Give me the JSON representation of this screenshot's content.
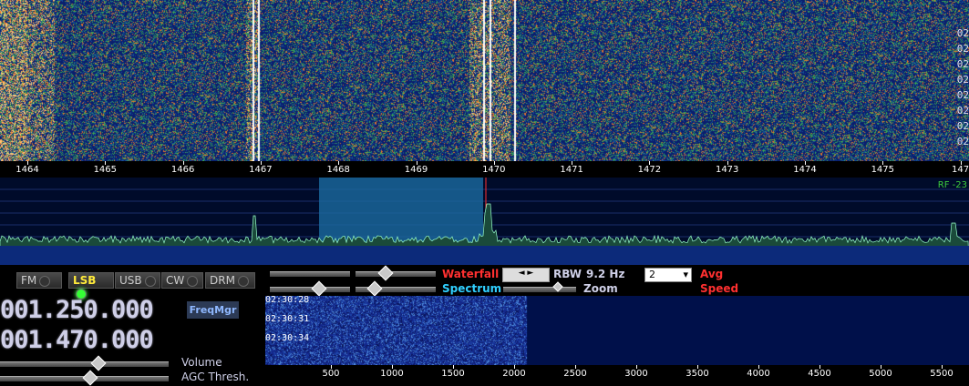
{
  "waterfall": {
    "time_labels": [
      "02",
      "02",
      "02",
      "02",
      "02",
      "02",
      "02",
      "02"
    ]
  },
  "main_axis": {
    "ticks": [
      "1464",
      "1465",
      "1466",
      "1467",
      "1468",
      "1469",
      "1470",
      "1471",
      "1472",
      "1473",
      "1474",
      "1475",
      "147"
    ]
  },
  "spectrum": {
    "rf_label": "RF -23"
  },
  "modes": [
    {
      "label": "FM",
      "active": false
    },
    {
      "label": "LSB",
      "active": true
    },
    {
      "label": "USB",
      "active": false
    },
    {
      "label": "CW",
      "active": false
    },
    {
      "label": "DRM",
      "active": false
    }
  ],
  "frequencies": {
    "vfo_a": "001.250.000",
    "vfo_b": "001.470.000",
    "freqmgr_label": "FreqMgr"
  },
  "sliders": {
    "volume_label": "Volume",
    "agc_label": "AGC Thresh."
  },
  "display_controls": {
    "waterfall_label": "Waterfall",
    "spectrum_label": "Spectrum",
    "zoom_label": "Zoom",
    "rbw_label": "RBW",
    "rbw_value": "9.2 Hz",
    "avg_value": "2",
    "avg_label": "Avg",
    "speed_label": "Speed",
    "colors": {
      "waterfall": "#ff3030",
      "spectrum": "#30d0ff",
      "avg": "#ff3030",
      "speed": "#ff3030"
    }
  },
  "audio_waterfall": {
    "time_labels": [
      "02:30:28",
      "02:30:31",
      "02:30:34"
    ],
    "axis_ticks": [
      "500",
      "1000",
      "1500",
      "2000",
      "2500",
      "3000",
      "3500",
      "4000",
      "4500",
      "5000",
      "5500"
    ]
  }
}
